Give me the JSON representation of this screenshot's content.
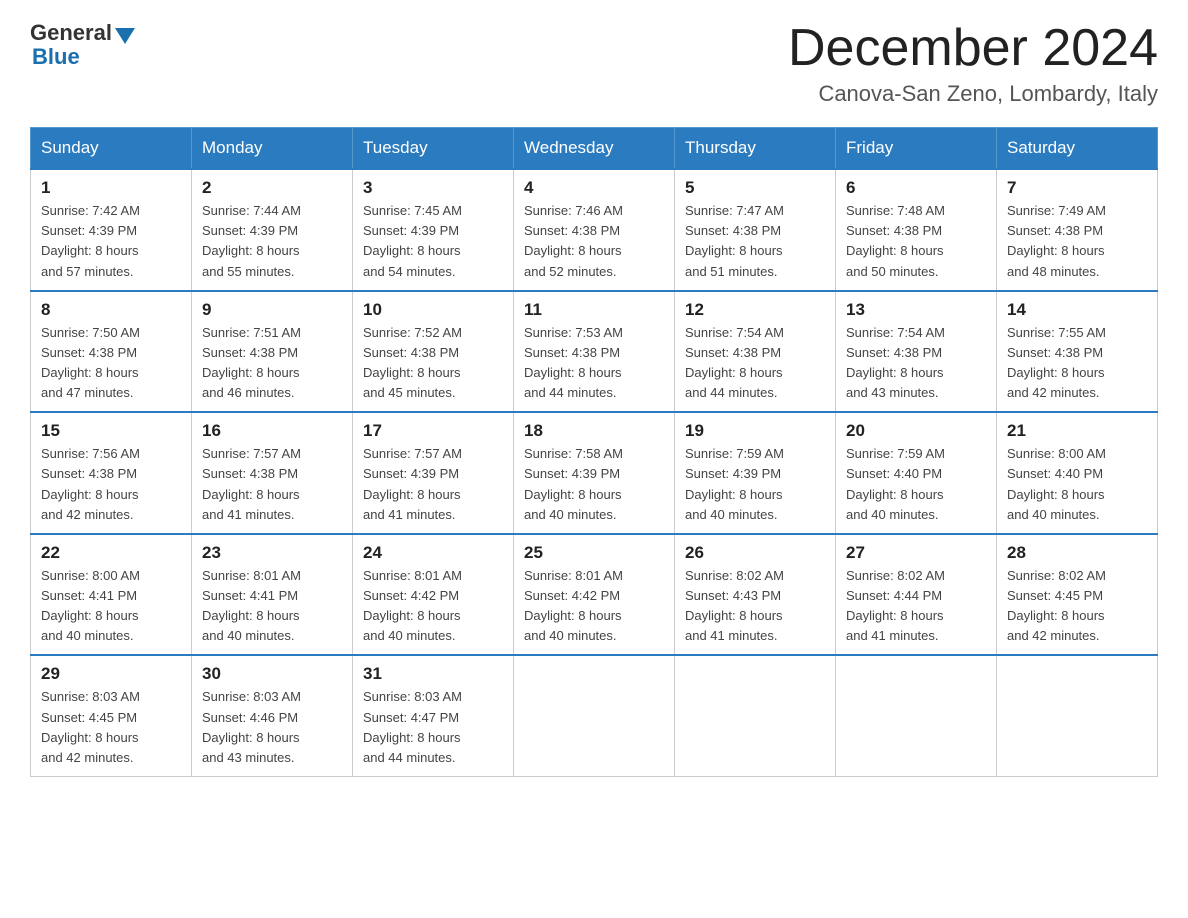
{
  "header": {
    "logo_general": "General",
    "logo_blue": "Blue",
    "month_title": "December 2024",
    "location": "Canova-San Zeno, Lombardy, Italy"
  },
  "days_of_week": [
    "Sunday",
    "Monday",
    "Tuesday",
    "Wednesday",
    "Thursday",
    "Friday",
    "Saturday"
  ],
  "weeks": [
    [
      {
        "day": "1",
        "sunrise": "7:42 AM",
        "sunset": "4:39 PM",
        "daylight": "8 hours and 57 minutes."
      },
      {
        "day": "2",
        "sunrise": "7:44 AM",
        "sunset": "4:39 PM",
        "daylight": "8 hours and 55 minutes."
      },
      {
        "day": "3",
        "sunrise": "7:45 AM",
        "sunset": "4:39 PM",
        "daylight": "8 hours and 54 minutes."
      },
      {
        "day": "4",
        "sunrise": "7:46 AM",
        "sunset": "4:38 PM",
        "daylight": "8 hours and 52 minutes."
      },
      {
        "day": "5",
        "sunrise": "7:47 AM",
        "sunset": "4:38 PM",
        "daylight": "8 hours and 51 minutes."
      },
      {
        "day": "6",
        "sunrise": "7:48 AM",
        "sunset": "4:38 PM",
        "daylight": "8 hours and 50 minutes."
      },
      {
        "day": "7",
        "sunrise": "7:49 AM",
        "sunset": "4:38 PM",
        "daylight": "8 hours and 48 minutes."
      }
    ],
    [
      {
        "day": "8",
        "sunrise": "7:50 AM",
        "sunset": "4:38 PM",
        "daylight": "8 hours and 47 minutes."
      },
      {
        "day": "9",
        "sunrise": "7:51 AM",
        "sunset": "4:38 PM",
        "daylight": "8 hours and 46 minutes."
      },
      {
        "day": "10",
        "sunrise": "7:52 AM",
        "sunset": "4:38 PM",
        "daylight": "8 hours and 45 minutes."
      },
      {
        "day": "11",
        "sunrise": "7:53 AM",
        "sunset": "4:38 PM",
        "daylight": "8 hours and 44 minutes."
      },
      {
        "day": "12",
        "sunrise": "7:54 AM",
        "sunset": "4:38 PM",
        "daylight": "8 hours and 44 minutes."
      },
      {
        "day": "13",
        "sunrise": "7:54 AM",
        "sunset": "4:38 PM",
        "daylight": "8 hours and 43 minutes."
      },
      {
        "day": "14",
        "sunrise": "7:55 AM",
        "sunset": "4:38 PM",
        "daylight": "8 hours and 42 minutes."
      }
    ],
    [
      {
        "day": "15",
        "sunrise": "7:56 AM",
        "sunset": "4:38 PM",
        "daylight": "8 hours and 42 minutes."
      },
      {
        "day": "16",
        "sunrise": "7:57 AM",
        "sunset": "4:38 PM",
        "daylight": "8 hours and 41 minutes."
      },
      {
        "day": "17",
        "sunrise": "7:57 AM",
        "sunset": "4:39 PM",
        "daylight": "8 hours and 41 minutes."
      },
      {
        "day": "18",
        "sunrise": "7:58 AM",
        "sunset": "4:39 PM",
        "daylight": "8 hours and 40 minutes."
      },
      {
        "day": "19",
        "sunrise": "7:59 AM",
        "sunset": "4:39 PM",
        "daylight": "8 hours and 40 minutes."
      },
      {
        "day": "20",
        "sunrise": "7:59 AM",
        "sunset": "4:40 PM",
        "daylight": "8 hours and 40 minutes."
      },
      {
        "day": "21",
        "sunrise": "8:00 AM",
        "sunset": "4:40 PM",
        "daylight": "8 hours and 40 minutes."
      }
    ],
    [
      {
        "day": "22",
        "sunrise": "8:00 AM",
        "sunset": "4:41 PM",
        "daylight": "8 hours and 40 minutes."
      },
      {
        "day": "23",
        "sunrise": "8:01 AM",
        "sunset": "4:41 PM",
        "daylight": "8 hours and 40 minutes."
      },
      {
        "day": "24",
        "sunrise": "8:01 AM",
        "sunset": "4:42 PM",
        "daylight": "8 hours and 40 minutes."
      },
      {
        "day": "25",
        "sunrise": "8:01 AM",
        "sunset": "4:42 PM",
        "daylight": "8 hours and 40 minutes."
      },
      {
        "day": "26",
        "sunrise": "8:02 AM",
        "sunset": "4:43 PM",
        "daylight": "8 hours and 41 minutes."
      },
      {
        "day": "27",
        "sunrise": "8:02 AM",
        "sunset": "4:44 PM",
        "daylight": "8 hours and 41 minutes."
      },
      {
        "day": "28",
        "sunrise": "8:02 AM",
        "sunset": "4:45 PM",
        "daylight": "8 hours and 42 minutes."
      }
    ],
    [
      {
        "day": "29",
        "sunrise": "8:03 AM",
        "sunset": "4:45 PM",
        "daylight": "8 hours and 42 minutes."
      },
      {
        "day": "30",
        "sunrise": "8:03 AM",
        "sunset": "4:46 PM",
        "daylight": "8 hours and 43 minutes."
      },
      {
        "day": "31",
        "sunrise": "8:03 AM",
        "sunset": "4:47 PM",
        "daylight": "8 hours and 44 minutes."
      },
      null,
      null,
      null,
      null
    ]
  ],
  "labels": {
    "sunrise": "Sunrise:",
    "sunset": "Sunset:",
    "daylight": "Daylight:"
  }
}
